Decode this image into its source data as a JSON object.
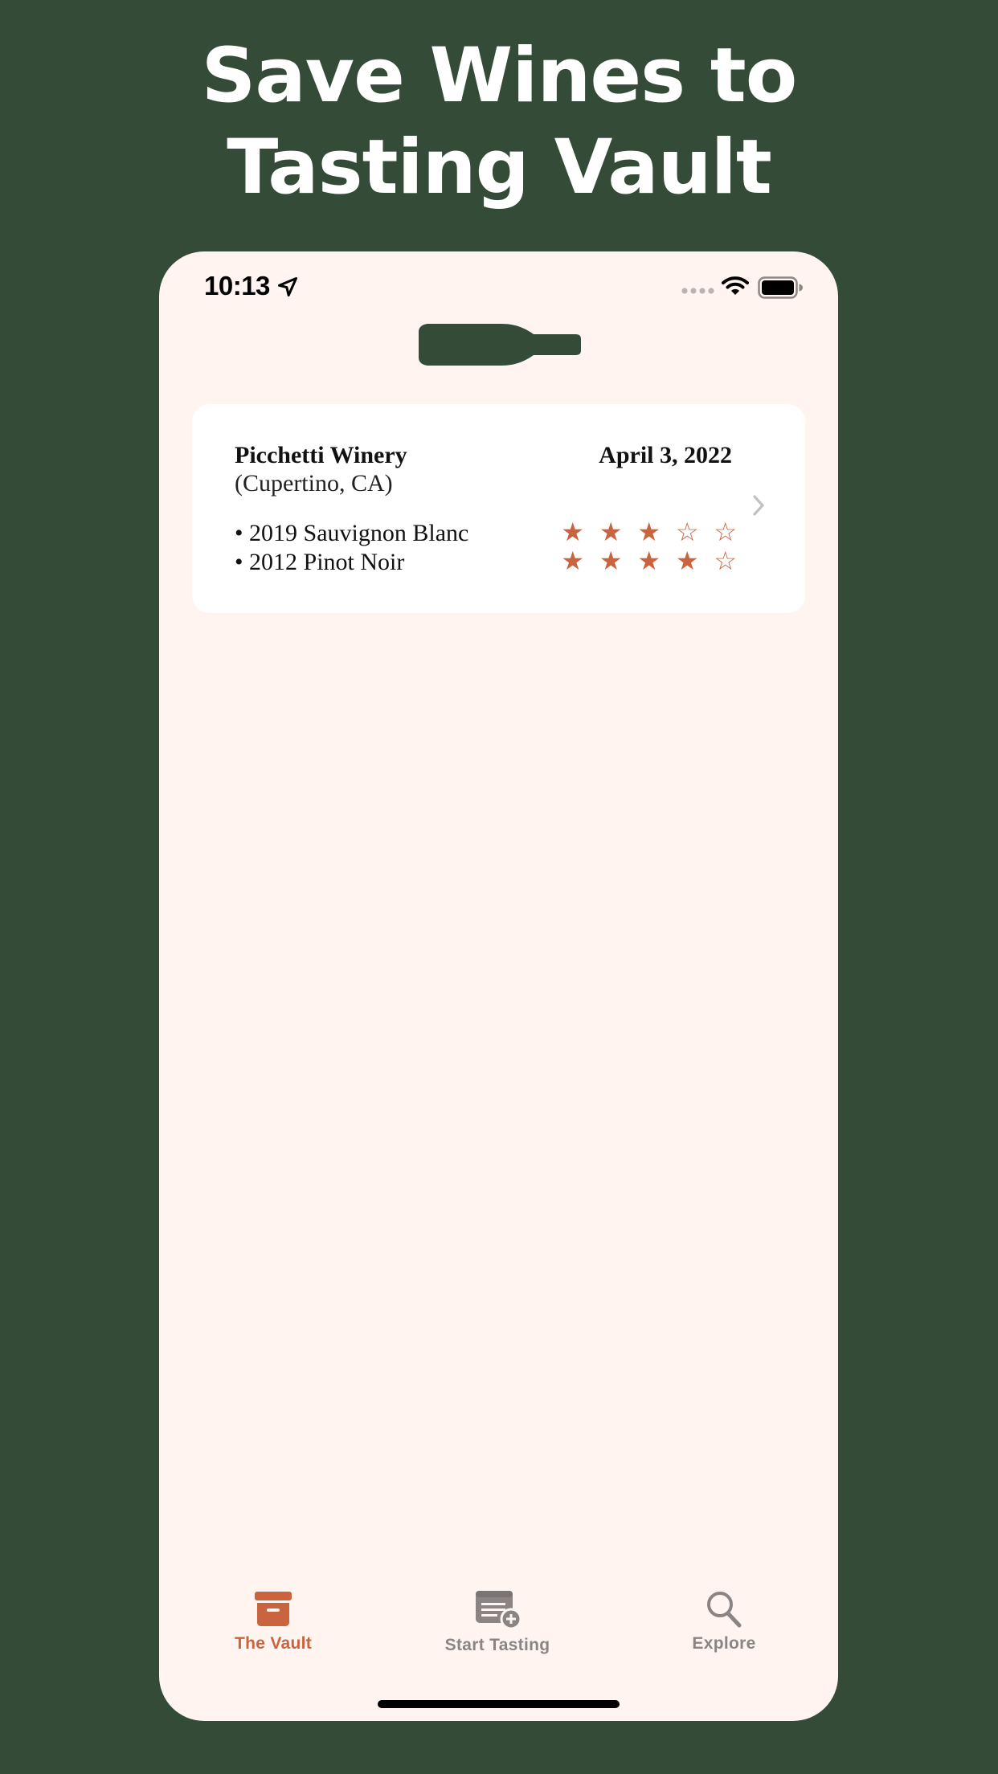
{
  "headline": {
    "line1": "Save Wines to",
    "line2": "Tasting Vault"
  },
  "colors": {
    "background": "#344b37",
    "screen": "#fff4f0",
    "accent": "#c9643f",
    "inactive_tab": "#8a8584",
    "bottle": "#344b37"
  },
  "status_bar": {
    "time": "10:13",
    "location_icon": "location-arrow-icon",
    "signal_icon": "signal-dots-icon",
    "wifi_icon": "wifi-icon",
    "battery_icon": "battery-icon"
  },
  "app_logo": {
    "icon": "wine-bottle-icon"
  },
  "vault_entries": [
    {
      "winery": "Picchetti Winery",
      "location": "(Cupertino, CA)",
      "date": "April 3, 2022",
      "wines": [
        {
          "name": "2019 Sauvignon Blanc",
          "rating": 3,
          "max_rating": 5
        },
        {
          "name": "2012 Pinot Noir",
          "rating": 4,
          "max_rating": 5
        }
      ]
    }
  ],
  "tabs": [
    {
      "label": "The Vault",
      "icon": "archive-box-icon",
      "active": true
    },
    {
      "label": "Start Tasting",
      "icon": "add-tasting-icon",
      "active": false
    },
    {
      "label": "Explore",
      "icon": "search-icon",
      "active": false
    }
  ]
}
